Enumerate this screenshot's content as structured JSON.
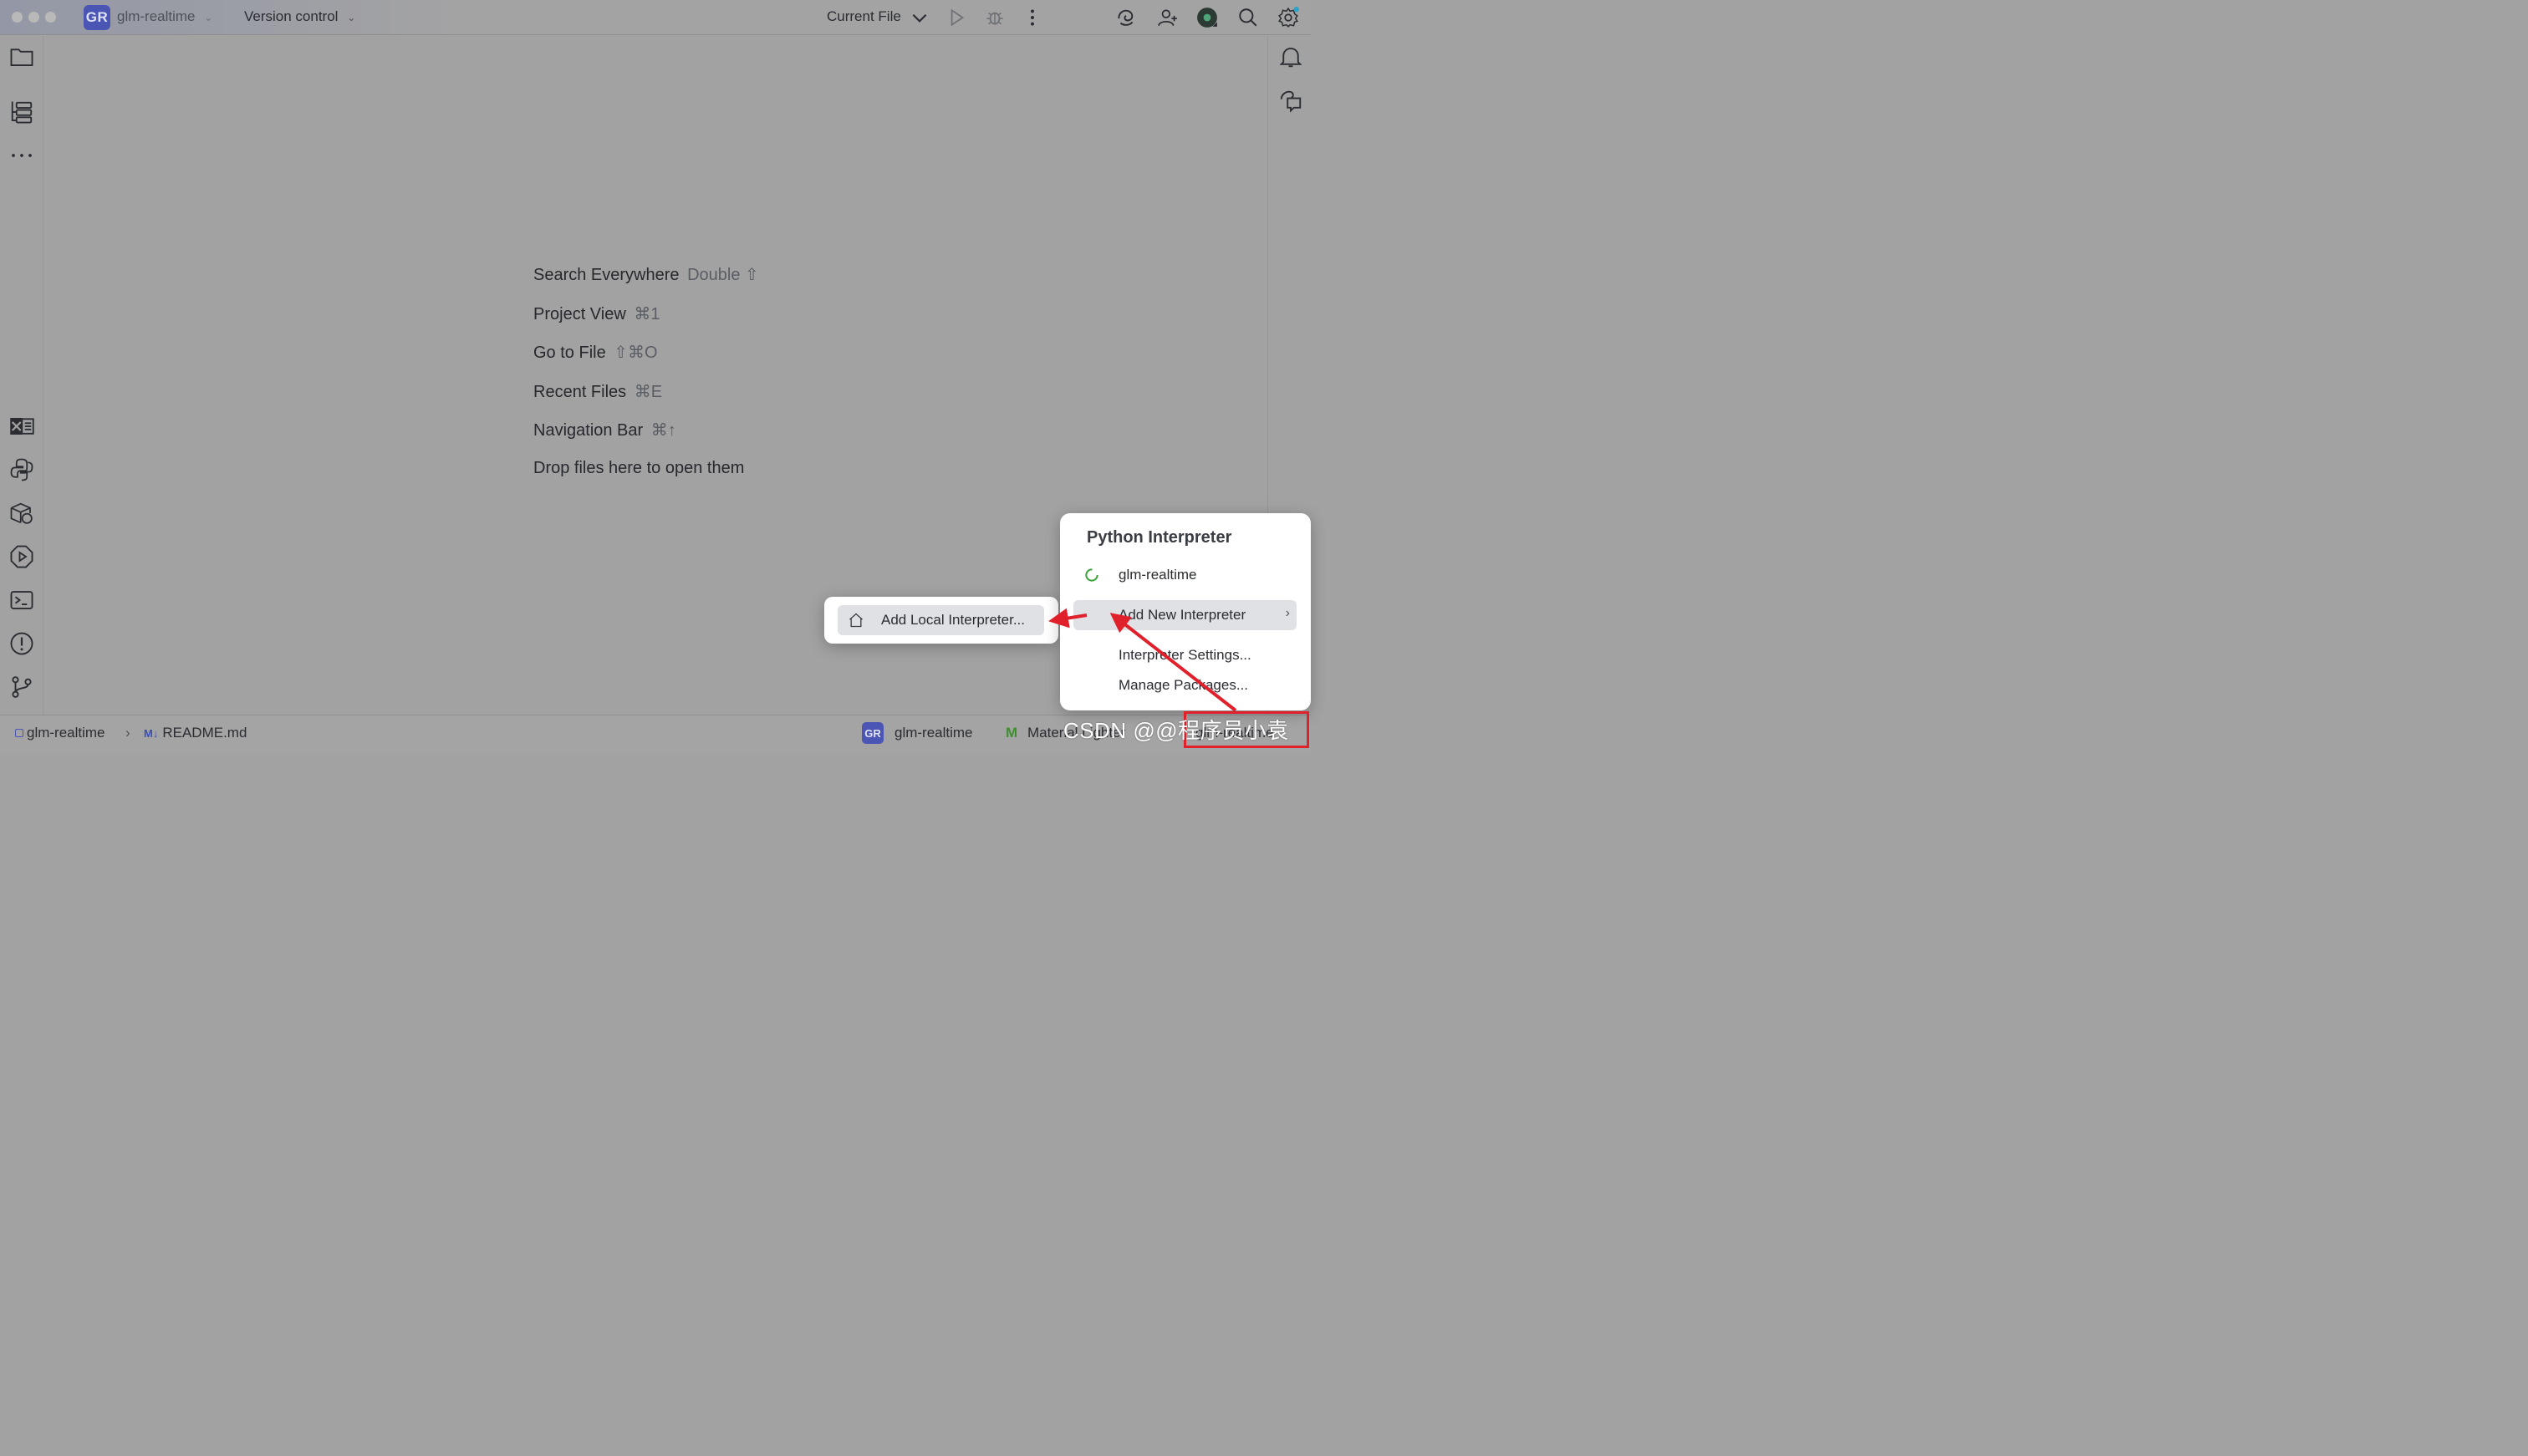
{
  "titlebar": {
    "project_badge": "GR",
    "project_name": "glm-realtime",
    "vcs_label": "Version control",
    "run_config": "Current File",
    "icons": [
      "run-icon",
      "debug-icon",
      "more-vertical-icon",
      "ai-assistant-icon",
      "add-user-icon",
      "avatar",
      "search-icon",
      "settings-icon"
    ]
  },
  "left_toolbar": {
    "icons": [
      "folder-icon",
      "structure-icon",
      "more-horizontal-icon",
      "excel-icon",
      "python-console-icon",
      "python-packages-icon",
      "services-icon",
      "terminal-icon",
      "problems-icon",
      "git-icon"
    ]
  },
  "right_toolbar": {
    "icons": [
      "notifications-icon",
      "ai-chat-icon"
    ]
  },
  "editor_hints": [
    {
      "label": "Search Everywhere",
      "shortcut": "Double ⇧"
    },
    {
      "label": "Project View",
      "shortcut": "⌘1"
    },
    {
      "label": "Go to File",
      "shortcut": "⇧⌘O"
    },
    {
      "label": "Recent Files",
      "shortcut": "⌘E"
    },
    {
      "label": "Navigation Bar",
      "shortcut": "⌘↑"
    },
    {
      "label": "Drop files here to open them",
      "shortcut": ""
    }
  ],
  "statusbar": {
    "breadcrumb_project": "glm-realtime",
    "breadcrumb_file": "README.md",
    "interpreter_badge": "GR",
    "interpreter_name": "glm-realtime",
    "theme": "Material Lighter",
    "interpreter_right": "glm-realtime"
  },
  "interpreter_popup": {
    "title": "Python Interpreter",
    "current": "glm-realtime",
    "add_new": "Add New Interpreter",
    "settings": "Interpreter Settings...",
    "manage": "Manage Packages..."
  },
  "submenu": {
    "add_local": "Add Local Interpreter..."
  },
  "watermark": "CSDN @@程序员小袁",
  "colors": {
    "annotation_red": "#e0212b",
    "badge_blue": "#4b56b4",
    "spinner_green": "#3aa03a",
    "material_green": "#3f8f2f"
  }
}
